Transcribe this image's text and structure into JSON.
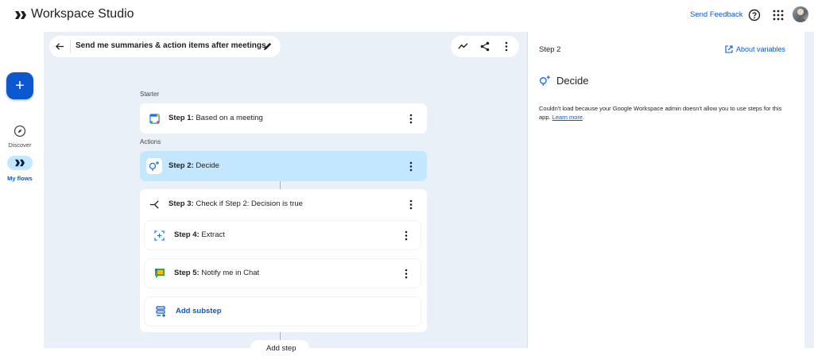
{
  "header": {
    "app_title": "Workspace Studio",
    "send_feedback": "Send Feedback",
    "icons": [
      "workspace-studio-logo-icon",
      "help-icon",
      "apps-grid-icon",
      "avatar"
    ]
  },
  "rail": {
    "new_label": "+",
    "discover_label": "Discover",
    "myflows_label": "My flows"
  },
  "flow": {
    "title": "Send me summaries & action items after meetings",
    "starter_label": "Starter",
    "actions_label": "Actions",
    "steps": [
      {
        "prefix": "Step 1:",
        "text": " Based on a meeting"
      },
      {
        "prefix": "Step 2:",
        "text": " Decide"
      },
      {
        "prefix": "Step 3:",
        "text": " Check if Step 2: Decision is true"
      },
      {
        "prefix": "Step 4:",
        "text": " Extract"
      },
      {
        "prefix": "Step 5:",
        "text": " Notify me in Chat"
      }
    ],
    "add_substep": "Add substep",
    "add_step_partial": "Add step"
  },
  "panel": {
    "step_label": "Step 2",
    "about_variables": "About variables",
    "title": "Decide",
    "message": "Couldn't load because your Google Workspace admin doesn't allow you to use steps for this app.",
    "learn_more": "Learn more",
    "message_end": "."
  },
  "colors": {
    "accent": "#0b57d0",
    "canvas_bg": "#eaf0f8",
    "selected_card": "#c2e7ff"
  }
}
